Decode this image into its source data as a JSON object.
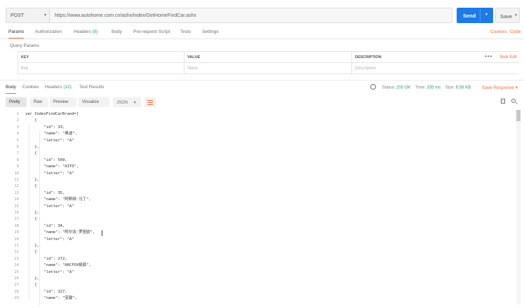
{
  "request": {
    "method": "POST",
    "url": "https://www.autohome.com.cn/ashx/index/GetHomeFindCar.ashx",
    "send_label": "Send",
    "save_label": "Save"
  },
  "request_tabs": [
    {
      "label": "Params",
      "count": ""
    },
    {
      "label": "Authorization",
      "count": ""
    },
    {
      "label": "Headers",
      "count": "(9)"
    },
    {
      "label": "Body",
      "count": ""
    },
    {
      "label": "Pre-request Script",
      "count": ""
    },
    {
      "label": "Tests",
      "count": ""
    },
    {
      "label": "Settings",
      "count": ""
    }
  ],
  "request_links": {
    "cookies": "Cookies",
    "code": "Code"
  },
  "query_params": {
    "label": "Query Params",
    "headers": [
      "KEY",
      "VALUE",
      "DESCRIPTION"
    ],
    "placeholders": [
      "Key",
      "Value",
      "Description"
    ],
    "more": "•••",
    "bulk_edit": "Bulk Edit"
  },
  "response_tabs": [
    {
      "label": "Body",
      "count": ""
    },
    {
      "label": "Cookies",
      "count": ""
    },
    {
      "label": "Headers",
      "count": "(12)"
    },
    {
      "label": "Test Results",
      "count": ""
    }
  ],
  "response_status": {
    "status_label": "Status:",
    "status_value": "200 OK",
    "time_label": "Time:",
    "time_value": "335 ms",
    "size_label": "Size:",
    "size_value": "6.58 KB",
    "save_response": "Save Response"
  },
  "view_modes": [
    "Pretty",
    "Raw",
    "Preview",
    "Visualize"
  ],
  "format": "JSON",
  "icons": {
    "method_caret": "chevron-down-icon",
    "send_caret": "chevron-down-icon",
    "globe": "globe-icon",
    "wrap": "wrap-lines-icon",
    "copy": "copy-icon",
    "search": "search-icon"
  },
  "colors": {
    "accent": "#f26b3a",
    "send": "#1e7be6",
    "ok": "#26a65b"
  },
  "code_lines": [
    "var IndexFindCarBrand=[",
    "    {",
    "        \"id\": 33,",
    "        \"name\": \"奥迪\",",
    "        \"letter\": \"A\"",
    "    },",
    "    {",
    "        \"id\": 509,",
    "        \"name\": \"AITO\",",
    "        \"letter\": \"A\"",
    "    },",
    "    {",
    "        \"id\": 35,",
    "        \"name\": \"阿斯顿·马丁\",",
    "        \"letter\": \"A\"",
    "    },",
    "    {",
    "        \"id\": 34,",
    "        \"name\": \"阿尔法·罗密欧\",",
    "        \"letter\": \"A\"",
    "    },",
    "    {",
    "        \"id\": 272,",
    "        \"name\": \"ARCFOX极狐\",",
    "        \"letter\": \"A\"",
    "    },",
    "    {",
    "        \"id\": 327,",
    "        \"name\": \"宝骏\","
  ]
}
